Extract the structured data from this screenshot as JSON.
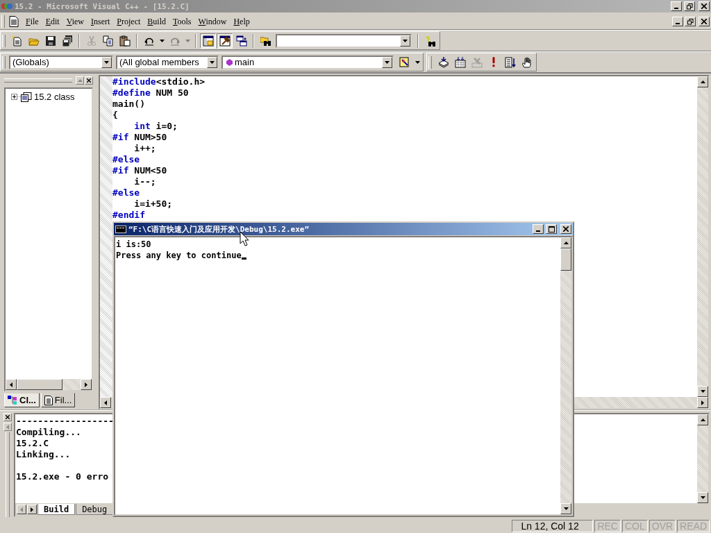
{
  "window": {
    "title": "15.2 - Microsoft Visual C++ - [15.2.C]"
  },
  "menu": [
    {
      "label": "File"
    },
    {
      "label": "Edit"
    },
    {
      "label": "View"
    },
    {
      "label": "Insert"
    },
    {
      "label": "Project"
    },
    {
      "label": "Build"
    },
    {
      "label": "Tools"
    },
    {
      "label": "Window"
    },
    {
      "label": "Help"
    }
  ],
  "toolbar": {
    "groups": [
      {
        "buttons": [
          {
            "kind": "new",
            "disabled": false,
            "pressed": false
          },
          {
            "kind": "open",
            "disabled": false,
            "pressed": false
          },
          {
            "kind": "save",
            "disabled": false,
            "pressed": false
          },
          {
            "kind": "save-all",
            "disabled": false,
            "pressed": false
          }
        ]
      },
      {
        "buttons": [
          {
            "kind": "cut",
            "disabled": true,
            "pressed": false
          },
          {
            "kind": "copy",
            "disabled": false,
            "pressed": false
          },
          {
            "kind": "paste",
            "disabled": false,
            "pressed": false
          }
        ]
      },
      {
        "buttons": [
          {
            "kind": "undo",
            "disabled": false,
            "pressed": false
          },
          {
            "kind": "dropdown",
            "disabled": false,
            "pressed": false
          },
          {
            "kind": "redo",
            "disabled": true,
            "pressed": false
          },
          {
            "kind": "dropdown",
            "disabled": true,
            "pressed": false
          }
        ]
      },
      {
        "buttons": [
          {
            "kind": "workspace",
            "disabled": false,
            "pressed": true
          },
          {
            "kind": "output",
            "disabled": false,
            "pressed": true
          },
          {
            "kind": "windows",
            "disabled": false,
            "pressed": false
          }
        ]
      },
      {
        "find_combo": true,
        "buttons": [
          {
            "kind": "find-in-files",
            "disabled": false,
            "pressed": false
          }
        ]
      },
      {
        "buttons": [
          {
            "kind": "help-search",
            "disabled": false,
            "pressed": false
          }
        ]
      }
    ]
  },
  "context_bar": {
    "class_combo": "(Globals)",
    "members_combo": "(All global members",
    "function_combo": "main"
  },
  "build_toolbar": [
    {
      "kind": "compile",
      "disabled": false
    },
    {
      "kind": "build",
      "disabled": false
    },
    {
      "kind": "stop",
      "disabled": true
    },
    {
      "kind": "execute",
      "disabled": false
    },
    {
      "kind": "go",
      "disabled": false
    },
    {
      "kind": "breakpoint",
      "disabled": false
    }
  ],
  "workspace": {
    "tree": [
      {
        "label": "15.2 class",
        "expanded": false
      }
    ],
    "tabs": [
      {
        "label": "Cl...",
        "kind": "classes",
        "selected": true
      },
      {
        "label": "Fil...",
        "kind": "files",
        "selected": false
      }
    ]
  },
  "editor": {
    "lines": [
      [
        {
          "text": "#include",
          "kind": "keyword"
        },
        {
          "text": "<stdio.h>",
          "kind": "plain"
        }
      ],
      [
        {
          "text": "#define",
          "kind": "keyword"
        },
        {
          "text": " NUM 50",
          "kind": "plain"
        }
      ],
      [
        {
          "text": "main()",
          "kind": "plain"
        }
      ],
      [
        {
          "text": "{",
          "kind": "plain"
        }
      ],
      [
        {
          "text": "    int",
          "kind": "keyword"
        },
        {
          "text": " i=0;",
          "kind": "plain"
        }
      ],
      [
        {
          "text": "#if",
          "kind": "keyword"
        },
        {
          "text": " NUM>50",
          "kind": "plain"
        }
      ],
      [
        {
          "text": "    i++;",
          "kind": "plain"
        }
      ],
      [
        {
          "text": "#else",
          "kind": "keyword"
        }
      ],
      [
        {
          "text": "#if",
          "kind": "keyword"
        },
        {
          "text": " NUM<50",
          "kind": "plain"
        }
      ],
      [
        {
          "text": "    i--;",
          "kind": "plain"
        }
      ],
      [
        {
          "text": "#else",
          "kind": "keyword"
        }
      ],
      [
        {
          "text": "    i=i+50;",
          "kind": "plain"
        }
      ],
      [
        {
          "text": "#endif",
          "kind": "keyword"
        }
      ]
    ]
  },
  "output": {
    "blocks": [
      [
        "------------------",
        "Compiling...",
        "15.2.C",
        "Linking..."
      ],
      [
        "15.2.exe - 0 erro"
      ]
    ],
    "tabs": [
      {
        "label": "Build",
        "selected": true
      },
      {
        "label": "Debug",
        "selected": false
      }
    ]
  },
  "console": {
    "title": "“F:\\C语言快速入门及应用开发\\Debug\\15.2.exe”",
    "lines": [
      "i is:50",
      "Press any key to continue"
    ],
    "cursor": true
  },
  "status_bar": {
    "position": "Ln 12, Col 12",
    "indicators": [
      {
        "label": "REC",
        "on": false
      },
      {
        "label": "COL",
        "on": false
      },
      {
        "label": "OVR",
        "on": false
      },
      {
        "label": "READ",
        "on": false
      }
    ]
  }
}
